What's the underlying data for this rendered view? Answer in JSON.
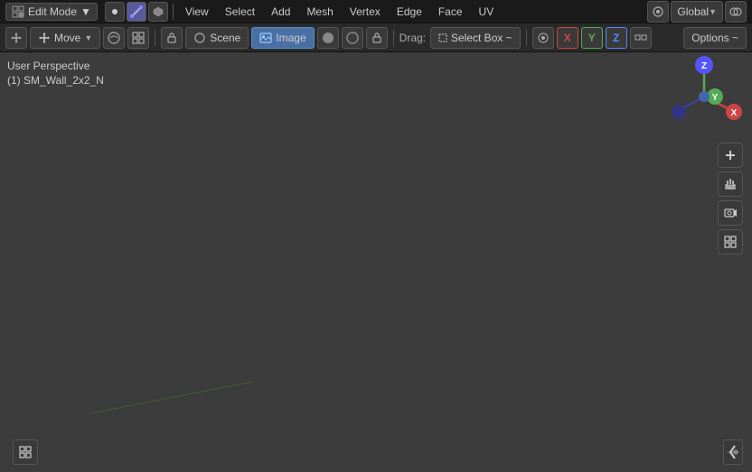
{
  "menubar": {
    "mode": "Edit Mode",
    "items": [
      "View",
      "Select",
      "Add",
      "Mesh",
      "Vertex",
      "Edge",
      "Face",
      "UV"
    ],
    "global_label": "Global",
    "mode_icon": "✦"
  },
  "toolbar": {
    "transform_mode": "Move",
    "transform_orientation": "↺",
    "pivot_label": "Scene",
    "shading_label": "Image",
    "drag_label": "Drag:",
    "select_box_label": "Select Box ~",
    "options_label": "Options ~",
    "x_axis": "X",
    "y_axis": "Y",
    "z_axis": "Z",
    "proportional_icon": "⊙"
  },
  "viewport": {
    "perspective_label": "User Perspective",
    "object_label": "(1) SM_Wall_2x2_N"
  },
  "gizmo": {
    "z_color": "#5555ff",
    "y_color": "#55aa55",
    "x_color": "#cc4444",
    "dot_color": "#4466aa"
  },
  "right_tools": {
    "buttons": [
      "+",
      "✋",
      "🎥",
      "⊞"
    ]
  },
  "bottom_left": {
    "icon": "⊞"
  }
}
